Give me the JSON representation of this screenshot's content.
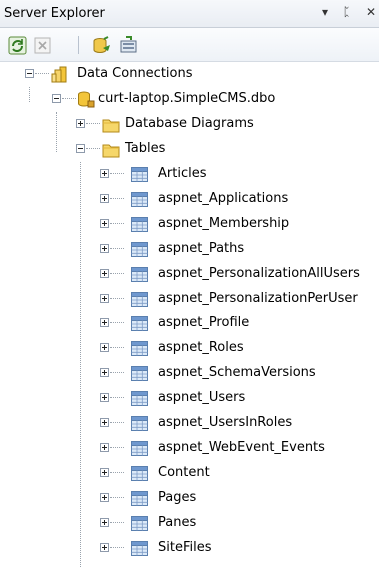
{
  "panel": {
    "title": "Server Explorer",
    "pin_glyph": "▾",
    "autohide_glyph": "ᛈ",
    "close_glyph": "✕"
  },
  "toolbar": {
    "buttons": [
      {
        "name": "refresh-icon",
        "enabled": true
      },
      {
        "name": "stop-refresh-icon",
        "enabled": false
      },
      {
        "name": "connect-to-database-icon",
        "enabled": true
      },
      {
        "name": "connect-to-server-icon",
        "enabled": true
      }
    ]
  },
  "tree": {
    "data_connections": "Data Connections",
    "connection": "curt-laptop.SimpleCMS.dbo",
    "database_diagrams": "Database Diagrams",
    "tables_label": "Tables",
    "tables": [
      "Articles",
      "aspnet_Applications",
      "aspnet_Membership",
      "aspnet_Paths",
      "aspnet_PersonalizationAllUsers",
      "aspnet_PersonalizationPerUser",
      "aspnet_Profile",
      "aspnet_Roles",
      "aspnet_SchemaVersions",
      "aspnet_Users",
      "aspnet_UsersInRoles",
      "aspnet_WebEvent_Events",
      "Content",
      "Pages",
      "Panes",
      "SiteFiles"
    ]
  }
}
